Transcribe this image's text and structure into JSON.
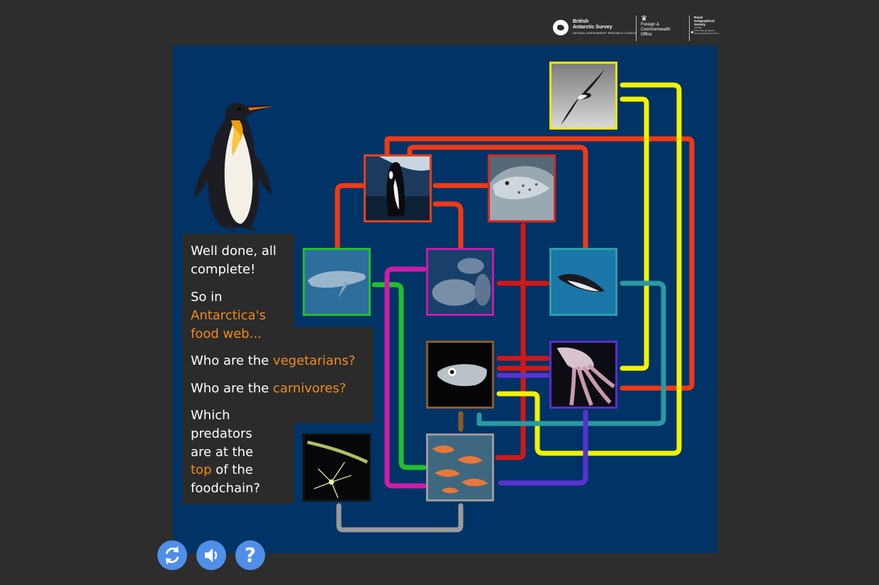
{
  "logos": {
    "bas": {
      "name": "British\nAntarctic Survey",
      "sub": "NATURAL ENVIRONMENT RESEARCH COUNCIL"
    },
    "fco": {
      "name": "Foreign &\nCommonwealth\nOffice"
    },
    "rgs": {
      "name": "Royal\nGeographical\nSociety",
      "sub": "with IBG\nAdvancing geography\nand geographical learning"
    }
  },
  "message": {
    "line1": "Well done, all",
    "line2": "complete!",
    "q0_a": "So in",
    "q0_b": "Antarctica's",
    "q0_c": "food web...",
    "q1_pre": "Who are the ",
    "q1_hl": "vegetarians?",
    "q2_pre": "Who are the ",
    "q2_hl": "carnivores?",
    "q3_a": "Which",
    "q3_b": "predators",
    "q3_c": "are at the",
    "q3_d_hl": "top",
    "q3_d_post": " of the",
    "q3_e": "foodchain?"
  },
  "tiles": [
    {
      "name": "albatross",
      "border": "#f2e600"
    },
    {
      "name": "orca",
      "border": "#e8401c"
    },
    {
      "name": "leopard-seal",
      "border": "#d42a1e"
    },
    {
      "name": "blue-whale",
      "border": "#22c02a"
    },
    {
      "name": "seals",
      "border": "#c21ca8"
    },
    {
      "name": "penguin-swimming",
      "border": "#28a0a8"
    },
    {
      "name": "fish",
      "border": "#8a5a2a"
    },
    {
      "name": "squid",
      "border": "#5a2ec8"
    },
    {
      "name": "phytoplankton",
      "border": "#111111"
    },
    {
      "name": "krill",
      "border": "#9a9a9a"
    }
  ],
  "link_colors": {
    "red": "#f03a14",
    "dark_red": "#d01818",
    "yellow": "#f2f200",
    "green": "#22c02a",
    "magenta": "#d01ca8",
    "teal": "#2a9aa0",
    "purple": "#5a32d0",
    "brown": "#8a5a2a",
    "grey": "#9a9a9a"
  },
  "controls": {
    "restart_icon": "refresh-icon",
    "sound_icon": "speaker-icon",
    "help_label": "?"
  }
}
